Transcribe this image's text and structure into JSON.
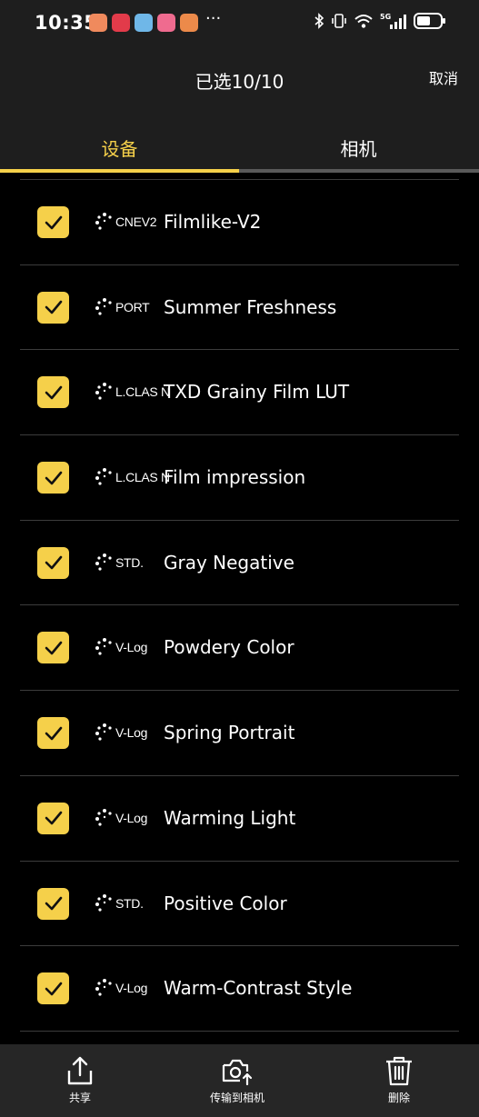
{
  "status_bar": {
    "time": "10:35"
  },
  "header": {
    "title": "已选10/10",
    "cancel_label": "取消"
  },
  "tabs": [
    {
      "label": "设备",
      "active": true
    },
    {
      "label": "相机",
      "active": false
    }
  ],
  "items": [
    {
      "badge": "CNEV2",
      "label": "Filmlike-V2",
      "checked": true
    },
    {
      "badge": "PORT",
      "label": "Summer Freshness",
      "checked": true
    },
    {
      "badge": "L.CLAS N",
      "label": "TXD Grainy Film LUT",
      "checked": true
    },
    {
      "badge": "L.CLAS N",
      "label": "Film impression",
      "checked": true
    },
    {
      "badge": "STD.",
      "label": "Gray Negative",
      "checked": true
    },
    {
      "badge": "V-Log",
      "label": "Powdery Color",
      "checked": true
    },
    {
      "badge": "V-Log",
      "label": "Spring Portrait",
      "checked": true
    },
    {
      "badge": "V-Log",
      "label": "Warming Light",
      "checked": true
    },
    {
      "badge": "STD.",
      "label": "Positive Color",
      "checked": true
    },
    {
      "badge": "V-Log",
      "label": "Warm-Contrast Style",
      "checked": true
    }
  ],
  "bottom_bar": {
    "share_label": "共享",
    "transfer_label": "传输到相机",
    "delete_label": "删除"
  },
  "colors": {
    "accent": "#f5d04a",
    "background": "#000000",
    "header": "#1e1e1e"
  }
}
